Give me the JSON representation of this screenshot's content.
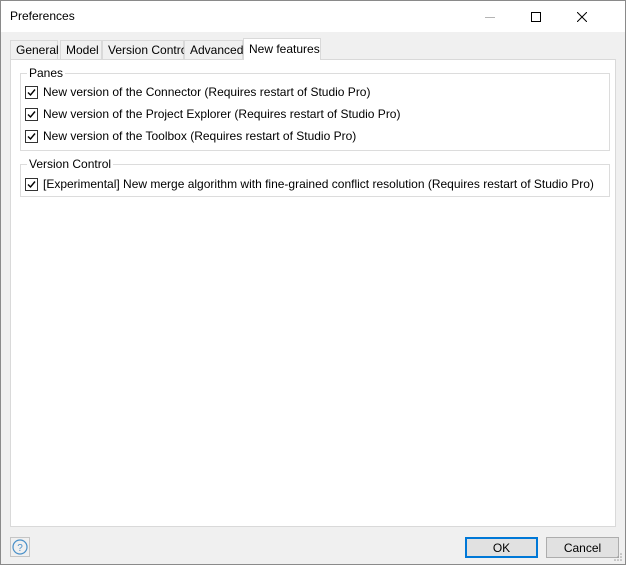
{
  "window": {
    "title": "Preferences",
    "controls": [
      "minimize-icon",
      "maximize-icon",
      "close-icon"
    ]
  },
  "tabs": [
    {
      "label": "General",
      "active": false
    },
    {
      "label": "Model",
      "active": false
    },
    {
      "label": "Version Control",
      "active": false
    },
    {
      "label": "Advanced",
      "active": false
    },
    {
      "label": "New features",
      "active": true
    }
  ],
  "groups": {
    "panes": {
      "label": "Panes",
      "items": [
        {
          "label": "New version of the Connector (Requires restart of Studio Pro)",
          "checked": true
        },
        {
          "label": "New version of the Project Explorer (Requires restart of Studio Pro)",
          "checked": true
        },
        {
          "label": "New version of the Toolbox (Requires restart of Studio Pro)",
          "checked": true
        }
      ]
    },
    "version_control": {
      "label": "Version Control",
      "items": [
        {
          "label": "[Experimental] New merge algorithm with fine-grained conflict resolution (Requires restart of Studio Pro)",
          "checked": true
        }
      ]
    }
  },
  "footer": {
    "help_icon": "help-icon",
    "ok_label": "OK",
    "cancel_label": "Cancel"
  },
  "colors": {
    "accent": "#0078d7",
    "window_bg": "#f0f0f0",
    "panel_bg": "#ffffff"
  }
}
